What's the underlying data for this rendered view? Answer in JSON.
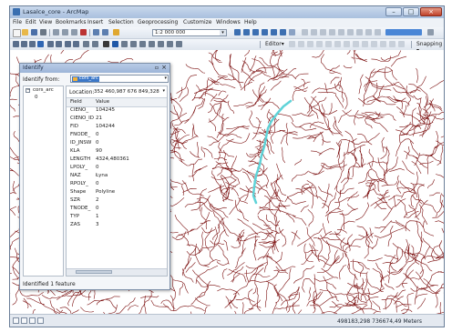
{
  "window": {
    "title": "Lasalce_core - ArcMap",
    "min_glyph": "–",
    "max_glyph": "□",
    "close_glyph": "×"
  },
  "menu": [
    "File",
    "Edit",
    "View",
    "Bookmarks",
    "Insert",
    "Selection",
    "Geoprocessing",
    "Customize",
    "Windows",
    "Help"
  ],
  "toolbar": {
    "scale_value": "1:2 000 000",
    "editor_label": "Editor▾",
    "snapping_label": "Snapping ▾"
  },
  "identify": {
    "title": "Identify",
    "from_label": "Identify from:",
    "from_value": "cors_arc",
    "tree_layer": "cors_arc",
    "tree_feature": "0",
    "location_label": "Location:",
    "location_value": "352 460,987 676 849,328",
    "col_field": "Field",
    "col_value": "Value",
    "rows": [
      {
        "field": "CIENO_",
        "value": "104245"
      },
      {
        "field": "CIENO_ID",
        "value": "21"
      },
      {
        "field": "FID",
        "value": "104244"
      },
      {
        "field": "FNODE_",
        "value": "0"
      },
      {
        "field": "ID_JNSW",
        "value": "0"
      },
      {
        "field": "KLA",
        "value": "90"
      },
      {
        "field": "LENGTH",
        "value": "4324,480361"
      },
      {
        "field": "LPOLY_",
        "value": "0"
      },
      {
        "field": "NAZ",
        "value": "Łyna"
      },
      {
        "field": "RPOLY_",
        "value": "0"
      },
      {
        "field": "Shape",
        "value": "Polyline"
      },
      {
        "field": "SZR",
        "value": "2"
      },
      {
        "field": "TNODE_",
        "value": "0"
      },
      {
        "field": "TYP",
        "value": "1"
      },
      {
        "field": "ZAS",
        "value": "3"
      }
    ],
    "status": "Identified 1 feature"
  },
  "status_bar": {
    "coordinates": "498183,298 736674,49 Meters"
  },
  "colors": {
    "river_network": "#7a0d0d",
    "selected_feature": "#5fd3d8",
    "accent": "#3b77c8"
  }
}
